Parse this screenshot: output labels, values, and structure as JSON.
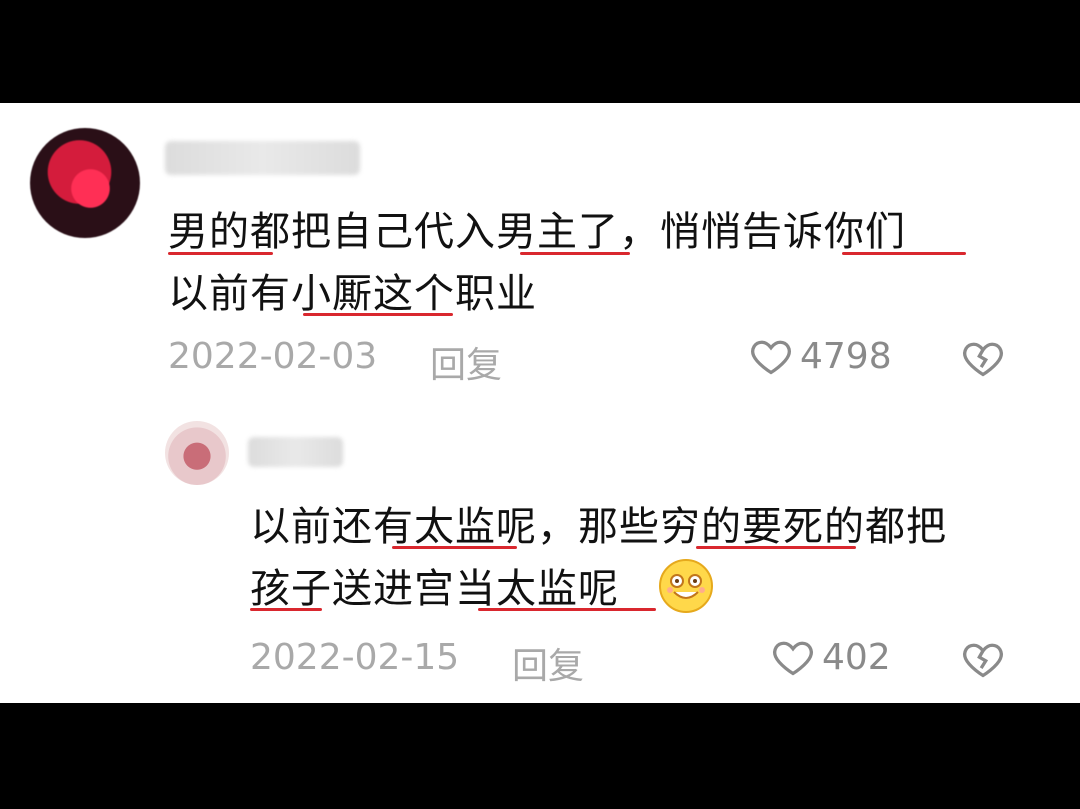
{
  "comments": [
    {
      "text_lines": [
        "男的都把自己代入男主了，悄悄告诉你们",
        "以前有小厮这个职业"
      ],
      "date": "2022-02-03",
      "reply_label": "回复",
      "likes": "4798"
    },
    {
      "text_lines": [
        "以前还有太监呢，那些穷的要死的都把",
        "孩子送进宫当太监呢"
      ],
      "date": "2022-02-15",
      "reply_label": "回复",
      "likes": "402"
    }
  ],
  "colors": {
    "underline": "#d9272e",
    "meta": "#a9a9a9",
    "text": "#111111"
  },
  "icons": {
    "like": "heart-outline-icon",
    "dislike": "broken-heart-icon",
    "emoji": "grinning-emoji-icon"
  }
}
